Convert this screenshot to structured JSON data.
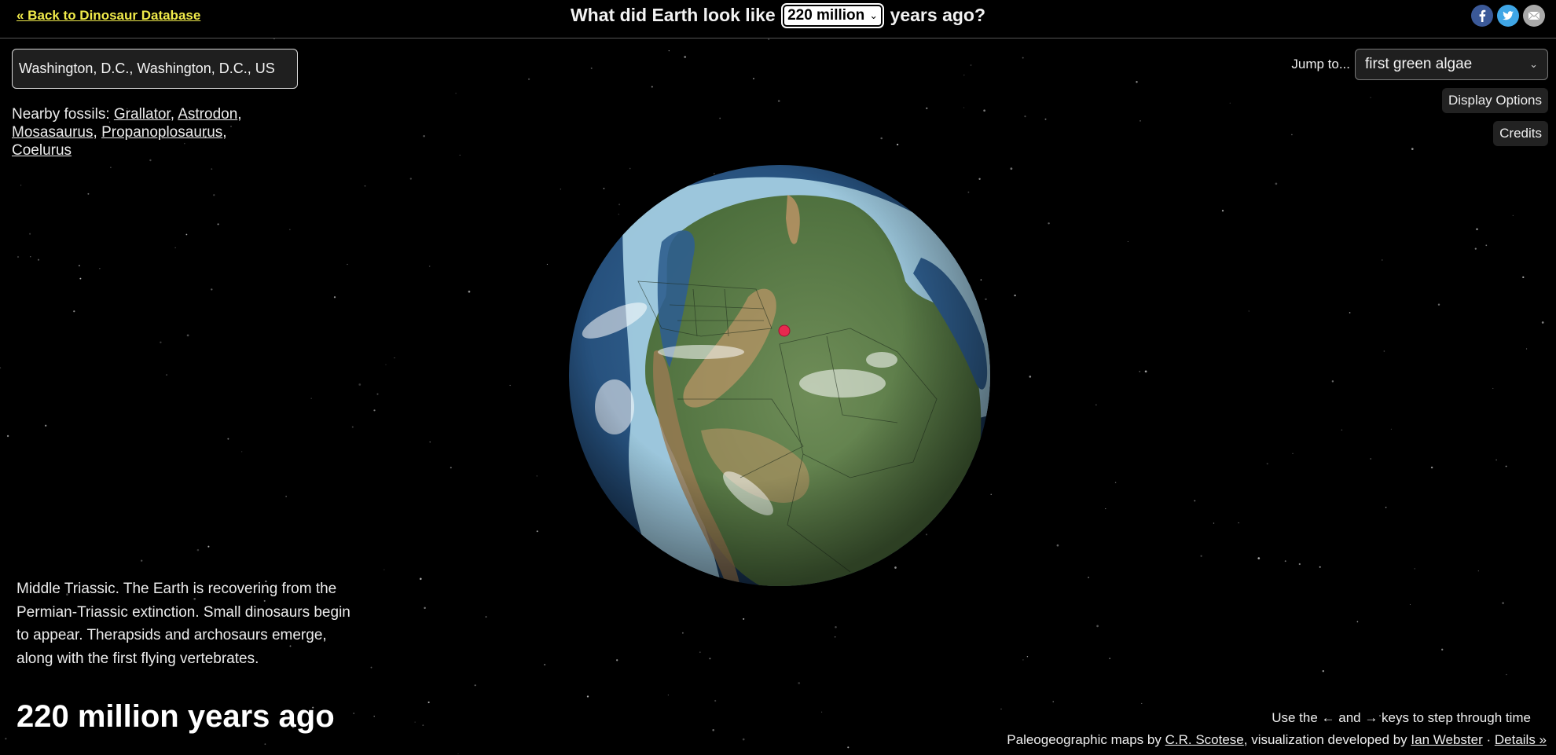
{
  "header": {
    "back_link": "« Back to Dinosaur Database",
    "title_prefix": "What did Earth look like",
    "age_selected": "220 million",
    "title_suffix": "years ago?",
    "social": [
      {
        "name": "facebook",
        "icon": "facebook-icon",
        "color": "#3b5998"
      },
      {
        "name": "twitter",
        "icon": "twitter-icon",
        "color": "#3fa6e6"
      },
      {
        "name": "email",
        "icon": "email-icon",
        "color": "#a9a9a9"
      }
    ]
  },
  "location": {
    "value": "Washington, D.C., Washington, D.C., US"
  },
  "nearby": {
    "label": "Nearby fossils:",
    "fossils": [
      "Grallator",
      "Astrodon",
      "Mosasaurus",
      "Propanoplosaurus",
      "Coelurus"
    ]
  },
  "jump": {
    "label": "Jump to...",
    "selected": "first green algae"
  },
  "buttons": {
    "display_options": "Display Options",
    "credits": "Credits"
  },
  "globe": {
    "marker_color": "#e8294f",
    "marker_label": "Washington, D.C."
  },
  "description": "Middle Triassic. The Earth is recovering from the Permian-Triassic extinction. Small dinosaurs begin to appear. Therapsids and archosaurs emerge, along with the first flying vertebrates.",
  "age_display": "220 million years ago",
  "footer": {
    "keys_hint": "Use the ← and → keys to step through time",
    "maps_by": "Paleogeographic maps by",
    "maps_author": "C.R. Scotese",
    "vis_by": ", visualization developed by",
    "vis_author": "Ian Webster",
    "separator": " · ",
    "details": "Details »"
  },
  "colors": {
    "link_yellow": "#f0ea4a",
    "background": "#000000"
  }
}
